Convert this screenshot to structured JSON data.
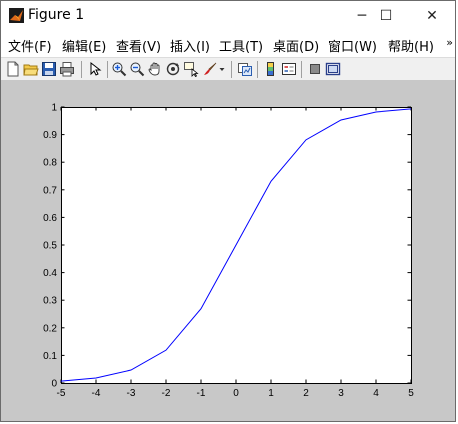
{
  "window": {
    "title": "Figure 1"
  },
  "window_controls": {
    "minimize": "─",
    "maximize": "☐",
    "close": "✕"
  },
  "menu": {
    "items": [
      {
        "label": "文件(F)"
      },
      {
        "label": "编辑(E)"
      },
      {
        "label": "查看(V)"
      },
      {
        "label": "插入(I)"
      },
      {
        "label": "工具(T)"
      },
      {
        "label": "桌面(D)"
      },
      {
        "label": "窗口(W)"
      },
      {
        "label": "帮助(H)"
      }
    ],
    "more": "»"
  },
  "toolbar": {
    "icons": [
      "new-figure-icon",
      "open-file-icon",
      "save-icon",
      "print-icon",
      "pointer-icon",
      "zoom-in-icon",
      "zoom-out-icon",
      "pan-hand-icon",
      "rotate-3d-icon",
      "data-cursor-icon",
      "brush-icon",
      "brush-dropdown-icon",
      "link-plot-icon",
      "colorbar-icon",
      "legend-icon",
      "hide-plot-tools-icon",
      "show-plot-tools-icon"
    ]
  },
  "chart_data": {
    "type": "line",
    "x": [
      -5,
      -4,
      -3,
      -2,
      -1,
      0,
      1,
      2,
      3,
      4,
      5
    ],
    "series": [
      {
        "values": [
          0.0067,
          0.018,
          0.047,
          0.119,
          0.269,
          0.5,
          0.731,
          0.881,
          0.953,
          0.982,
          0.993
        ],
        "color": "#0000ff"
      }
    ],
    "xlim": [
      -5,
      5
    ],
    "ylim": [
      0,
      1
    ],
    "xticks": [
      "-5",
      "-4",
      "-3",
      "-2",
      "-1",
      "0",
      "1",
      "2",
      "3",
      "4",
      "5"
    ],
    "yticks": [
      "0",
      "0.1",
      "0.2",
      "0.3",
      "0.4",
      "0.5",
      "0.6",
      "0.7",
      "0.8",
      "0.9",
      "1"
    ],
    "grid": false,
    "title": "",
    "xlabel": "",
    "ylabel": ""
  }
}
